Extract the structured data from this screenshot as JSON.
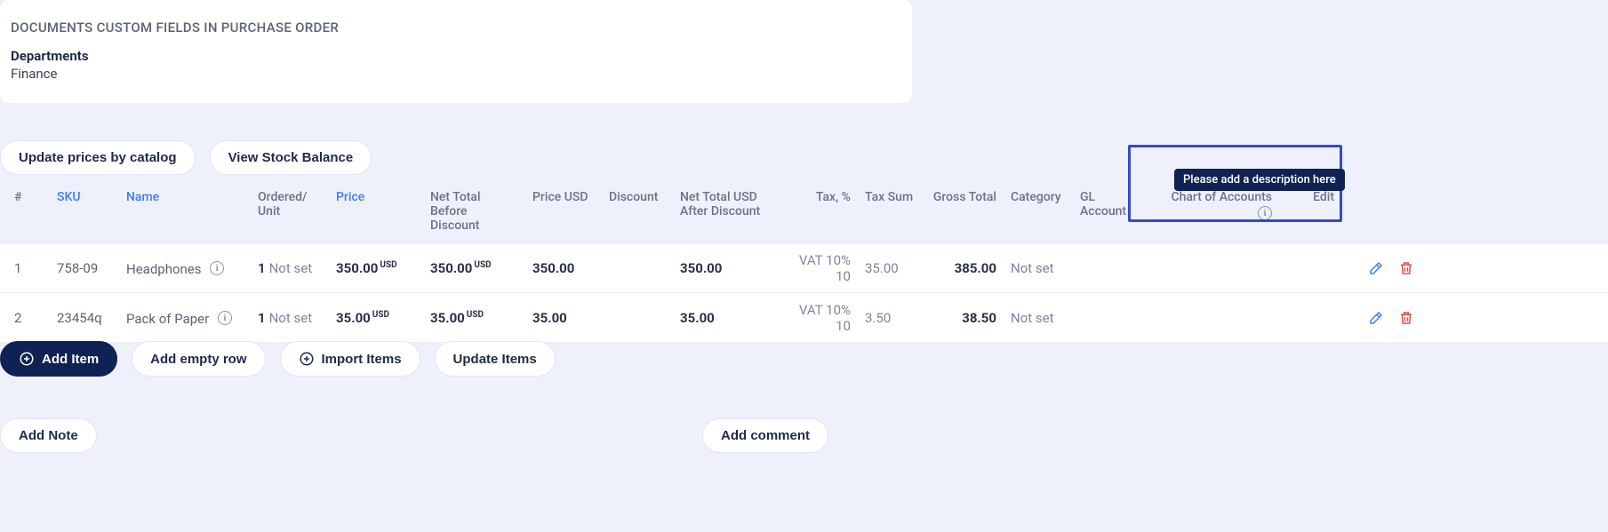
{
  "customFields": {
    "title": "DOCUMENTS CUSTOM FIELDS IN PURCHASE ORDER",
    "departmentsLabel": "Departments",
    "departmentsValue": "Finance"
  },
  "toolbar": {
    "updatePrices": "Update prices by catalog",
    "viewStock": "View Stock Balance"
  },
  "headers": {
    "idx": "#",
    "sku": "SKU",
    "name": "Name",
    "ord": "Ordered/\nUnit",
    "price": "Price",
    "netb": "Net Total\nBefore Discount",
    "pusd": "Price USD",
    "disc": "Discount",
    "neta": "Net Total USD\nAfter Discount",
    "tax": "Tax, %",
    "tsum": "Tax Sum",
    "gtot": "Gross Total",
    "cat": "Category",
    "gla": "GL Account",
    "coa": "Chart of Accounts",
    "edit": "Edit"
  },
  "tooltip": "Please add a description here",
  "rows": [
    {
      "idx": "1",
      "sku": "758-09",
      "name": "Headphones",
      "ordQty": "1",
      "ordUnit": "Not set",
      "priceVal": "350.00",
      "priceCur": "USD",
      "netbVal": "350.00",
      "netbCur": "USD",
      "pusd": "350.00",
      "disc": "",
      "neta": "350.00",
      "tax": "VAT 10% 10",
      "tsum": "35.00",
      "gtot": "385.00",
      "cat": "Not set",
      "gla": "",
      "coa": ""
    },
    {
      "idx": "2",
      "sku": "23454q",
      "name": "Pack of Paper",
      "ordQty": "1",
      "ordUnit": "Not set",
      "priceVal": "35.00",
      "priceCur": "USD",
      "netbVal": "35.00",
      "netbCur": "USD",
      "pusd": "35.00",
      "disc": "",
      "neta": "35.00",
      "tax": "VAT 10% 10",
      "tsum": "3.50",
      "gtot": "38.50",
      "cat": "Not set",
      "gla": "",
      "coa": ""
    }
  ],
  "bottomBar": {
    "addItem": "Add Item",
    "addEmpty": "Add empty row",
    "importItems": "Import Items",
    "updateItems": "Update Items"
  },
  "footer": {
    "addNote": "Add Note",
    "addComment": "Add comment"
  }
}
